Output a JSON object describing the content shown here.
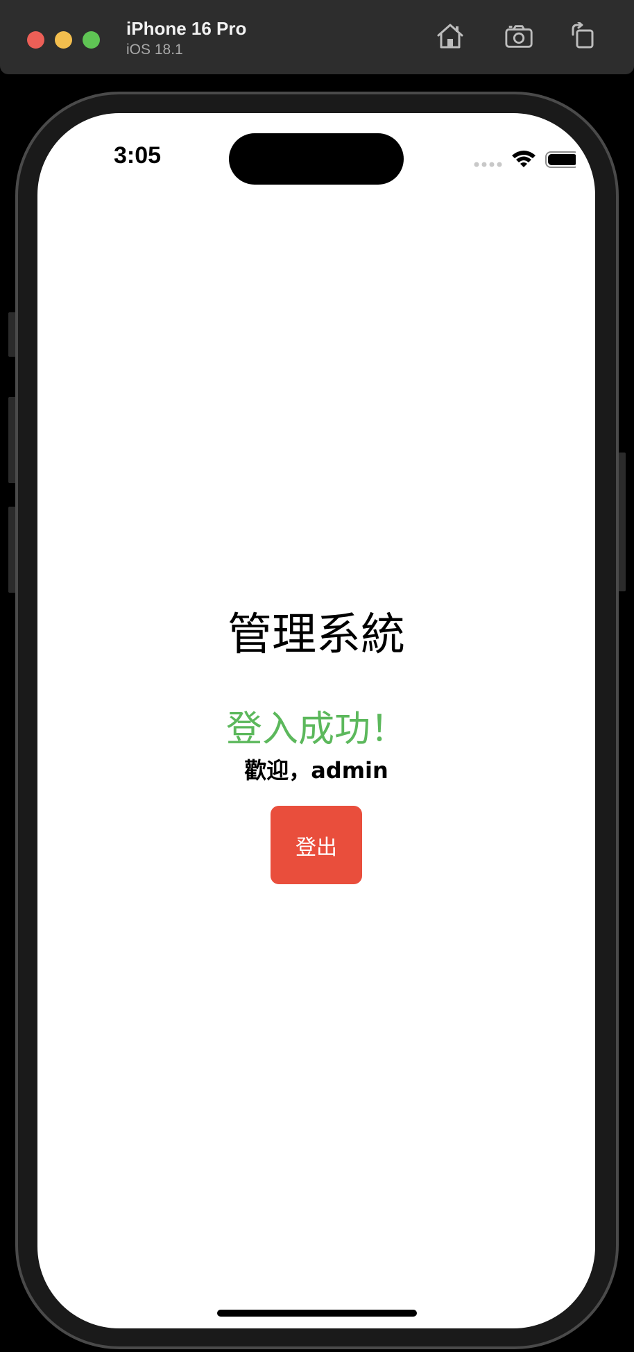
{
  "simulator": {
    "device_name": "iPhone 16 Pro",
    "os_version": "iOS 18.1",
    "icons": [
      "home-icon",
      "screenshot-icon",
      "rotate-icon"
    ]
  },
  "status_bar": {
    "time": "3:05",
    "icons": [
      "signal-icon",
      "wifi-icon",
      "battery-icon"
    ]
  },
  "app": {
    "title": "管理系統",
    "login_message": "登入成功！",
    "welcome_text": "歡迎，admin",
    "logout_label": "登出"
  },
  "colors": {
    "success": "#5cb85c",
    "danger": "#e94e3c"
  }
}
